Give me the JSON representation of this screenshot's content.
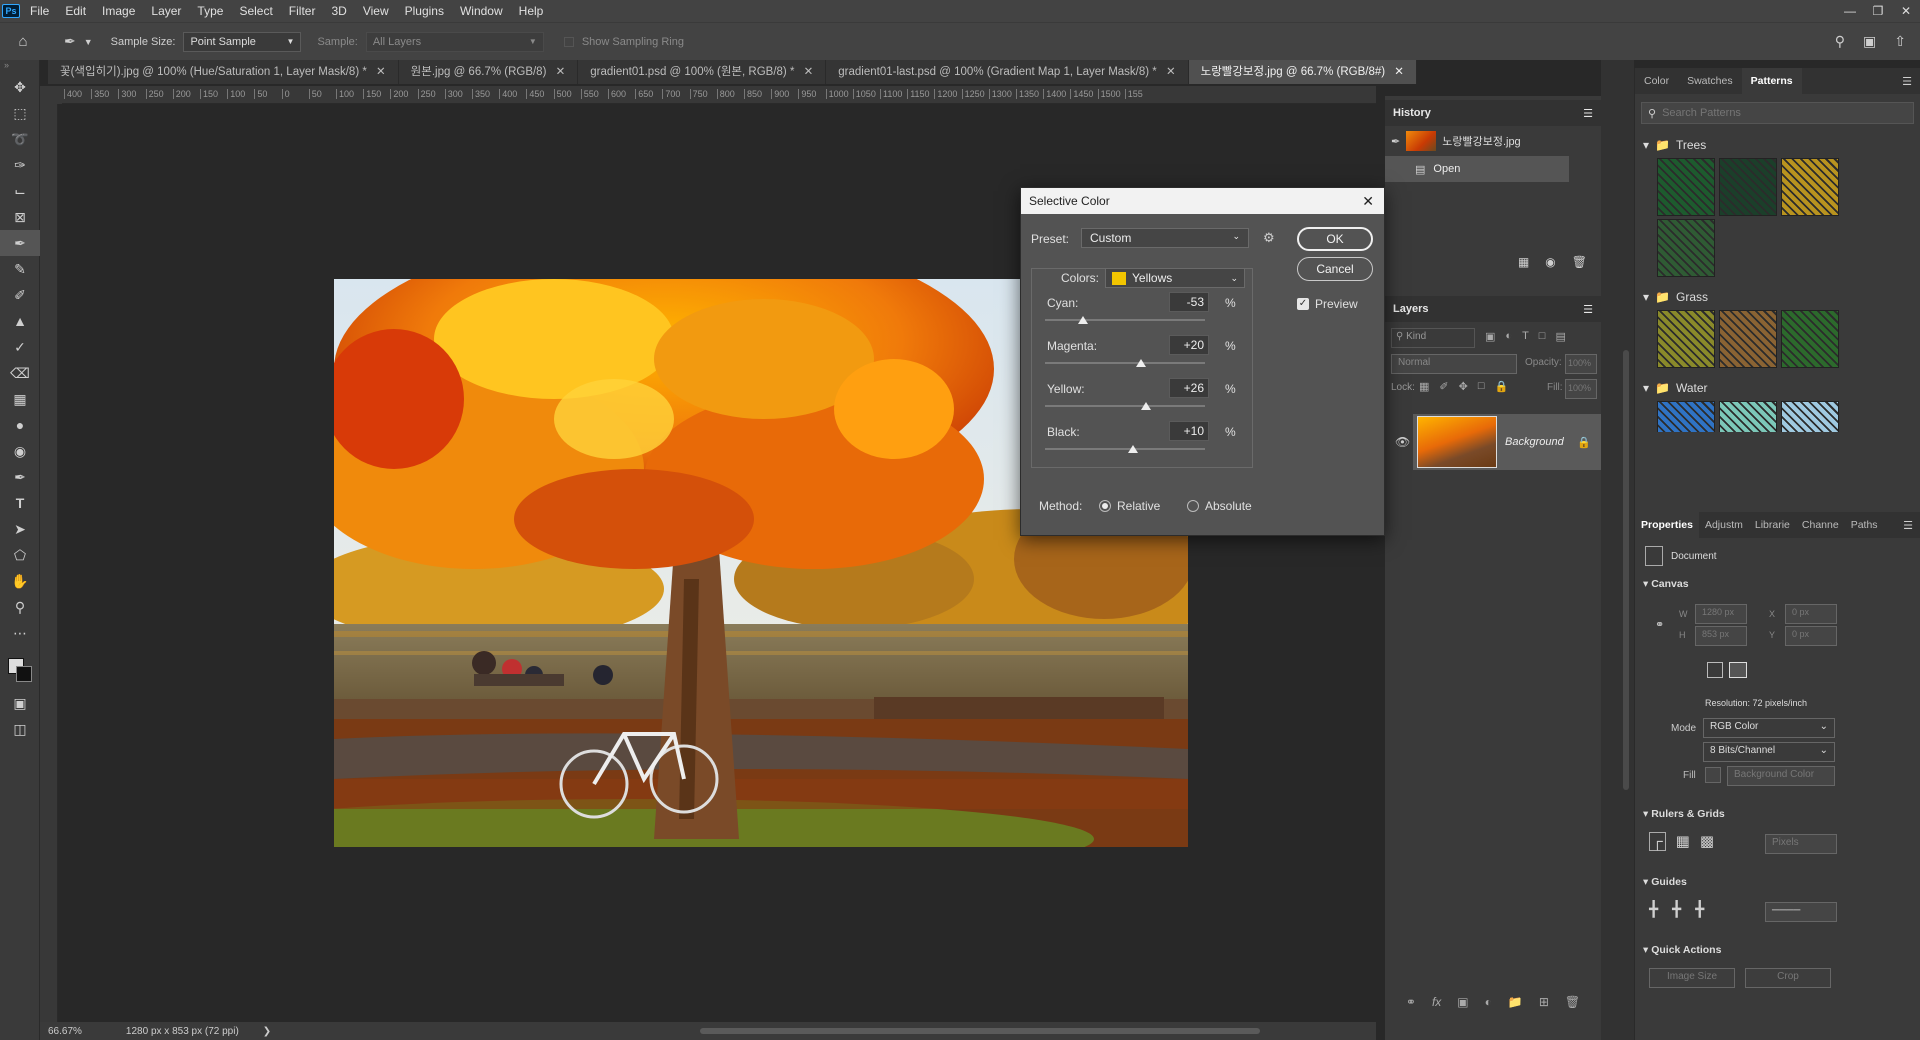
{
  "menubar": {
    "logo": "Ps",
    "items": [
      "File",
      "Edit",
      "Image",
      "Layer",
      "Type",
      "Select",
      "Filter",
      "3D",
      "View",
      "Plugins",
      "Window",
      "Help"
    ]
  },
  "options": {
    "sample_size_label": "Sample Size:",
    "sample_size_value": "Point Sample",
    "sample_label": "Sample:",
    "sample_value": "All Layers",
    "show_ring_label": "Show Sampling Ring"
  },
  "tabs": [
    "꽃(색입히기).jpg @ 100% (Hue/Saturation 1, Layer Mask/8) *",
    "원본.jpg @ 66.7% (RGB/8)",
    "gradient01.psd @ 100% (원본, RGB/8) *",
    "gradient01-last.psd @ 100% (Gradient Map 1, Layer Mask/8) *",
    "노랑빨강보정.jpg @ 66.7% (RGB/8#)"
  ],
  "ruler_ticks": [
    "400",
    "350",
    "300",
    "250",
    "200",
    "150",
    "100",
    "50",
    "0",
    "50",
    "100",
    "150",
    "200",
    "250",
    "300",
    "350",
    "400",
    "450",
    "500",
    "550",
    "600",
    "650",
    "700",
    "750",
    "800",
    "850",
    "900",
    "950",
    "1000",
    "1050",
    "1100",
    "1150",
    "1200",
    "1250",
    "1300",
    "1350",
    "1400",
    "1450",
    "1500",
    "155"
  ],
  "status": {
    "zoom": "66.67%",
    "doc_info": "1280 px x 853 px (72 ppi)"
  },
  "history": {
    "title": "History",
    "snapshot_name": "노랑빨강보정.jpg",
    "step": "Open"
  },
  "layers": {
    "title": "Layers",
    "filter_kind": "Kind",
    "blend_mode": "Normal",
    "opacity_label": "Opacity:",
    "opacity_value": "100%",
    "lock_label": "Lock:",
    "fill_label": "Fill:",
    "fill_value": "100%",
    "layer_name": "Background"
  },
  "right_tabs": [
    "Color",
    "Swatches",
    "Patterns"
  ],
  "patterns": {
    "search_placeholder": "Search Patterns",
    "groups": [
      {
        "name": "Trees",
        "colors": [
          "#1d5b2e",
          "#1b3f2a",
          "#b8931f",
          "#2f5b34"
        ]
      },
      {
        "name": "Grass",
        "colors": [
          "#8a8a2a",
          "#8a6333",
          "#2c6a2c"
        ]
      },
      {
        "name": "Water",
        "colors": [
          "#2f73c4",
          "#7cc7b8",
          "#9fc9e0"
        ]
      }
    ]
  },
  "properties": {
    "tabs": [
      "Properties",
      "Adjustm",
      "Librarie",
      "Channe",
      "Paths"
    ],
    "doc_label": "Document",
    "canvas_title": "Canvas",
    "w_label": "W",
    "w_value": "1280 px",
    "h_label": "H",
    "h_value": "853 px",
    "x_label": "X",
    "x_value": "0 px",
    "y_label": "Y",
    "y_value": "0 px",
    "resolution": "Resolution: 72 pixels/inch",
    "mode_label": "Mode",
    "mode_value": "RGB Color",
    "bits_value": "8 Bits/Channel",
    "fill_label": "Fill",
    "fill_value": "Background Color",
    "rulers_title": "Rulers & Grids",
    "units_value": "Pixels",
    "guides_title": "Guides",
    "quick_title": "Quick Actions",
    "image_size_btn": "Image Size",
    "crop_btn": "Crop"
  },
  "dialog": {
    "title": "Selective Color",
    "preset_label": "Preset:",
    "preset_value": "Custom",
    "colors_label": "Colors:",
    "colors_value": "Yellows",
    "ok": "OK",
    "cancel": "Cancel",
    "preview": "Preview",
    "sliders": [
      {
        "label": "Cyan:",
        "value": "-53",
        "num": -53
      },
      {
        "label": "Magenta:",
        "value": "+20",
        "num": 20
      },
      {
        "label": "Yellow:",
        "value": "+26",
        "num": 26
      },
      {
        "label": "Black:",
        "value": "+10",
        "num": 10
      }
    ],
    "percent": "%",
    "method_label": "Method:",
    "relative": "Relative",
    "absolute": "Absolute",
    "swatch_color": "#f2c500"
  }
}
